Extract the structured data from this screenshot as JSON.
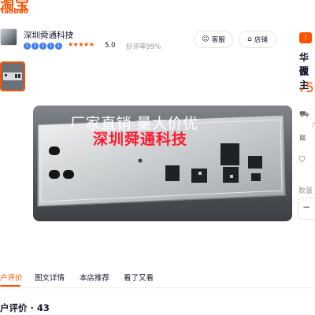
{
  "header": {
    "logo_cn": "淘宝",
    "logo_en": "Taobao",
    "brand_color": "#ff5000"
  },
  "shop": {
    "avatar_icon": "shop-avatar",
    "name": "深圳舜通科技",
    "chevron": "›",
    "badges": [
      "1",
      "1",
      "1",
      "1",
      "1"
    ],
    "stars": "★★★★★",
    "score": "5.0",
    "good_rate": "好评率99%",
    "service_button": {
      "icon": "smile-icon",
      "icon_glyph": "☺",
      "label": "客服"
    },
    "shop_button": {
      "icon": "store-icon",
      "icon_glyph": "⌂",
      "label": "店铺"
    }
  },
  "gallery": {
    "thumbnails": 1,
    "main_image": {
      "promo_line1": "厂家直销 量大价优",
      "promo_line2": "深圳舜通科技"
    }
  },
  "product_panel": {
    "tag": "!",
    "title_line1": "华硕",
    "title_line2": "做主",
    "price_currency": "¥",
    "price": "5",
    "info_rows": [
      {
        "icon": "truck-icon",
        "glyph": "⛟",
        "sub": "广"
      },
      {
        "icon": "box-icon",
        "glyph": "⊠",
        "sub": ""
      },
      {
        "icon": "shield-icon",
        "glyph": "⛉",
        "sub": ""
      }
    ],
    "quantity_label": "数量",
    "quantity_minus": "−"
  },
  "tabs": [
    {
      "label": "户评价",
      "active": true
    },
    {
      "label": "图文详情",
      "active": false
    },
    {
      "label": "本店推荐",
      "active": false
    },
    {
      "label": "看了又看",
      "active": false
    }
  ],
  "reviews": {
    "title": "户评价 · 43"
  }
}
